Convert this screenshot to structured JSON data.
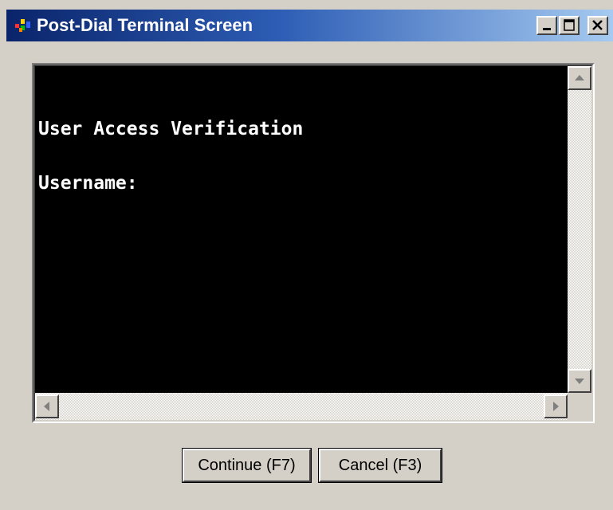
{
  "window": {
    "title": "Post-Dial Terminal Screen",
    "icon": "app-icon",
    "controls": [
      "minimize-icon",
      "maximize-icon",
      "close-icon"
    ]
  },
  "terminal": {
    "lines": [
      "User Access Verification",
      "",
      "Username:"
    ],
    "background": "#000000",
    "foreground": "#ffffff"
  },
  "buttons": {
    "continue_label": "Continue (F7)",
    "cancel_label": "Cancel (F3)"
  },
  "colors": {
    "title_gradient_start": "#0a246a",
    "title_gradient_end": "#a6caf0",
    "face": "#d4d0c8"
  }
}
